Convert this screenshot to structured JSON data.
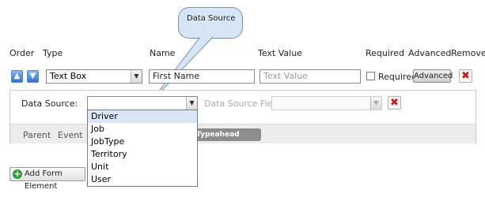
{
  "callout": {
    "label": "Data Source"
  },
  "headers": {
    "order": "Order",
    "type": "Type",
    "name": "Name",
    "text_value": "Text Value",
    "required": "Required",
    "advanced": "Advanced",
    "remove": "Remove"
  },
  "row": {
    "up_icon": "up-arrow",
    "down_icon": "down-arrow",
    "type_value": "Text Box",
    "name_value": "First Name",
    "text_value_placeholder": "Text Value",
    "required_label": "Required",
    "required_checked": false,
    "advanced_button": "Advanced"
  },
  "datasource": {
    "label": "Data Source:",
    "field_label": "Data Source Field:",
    "options": [
      "Driver",
      "Job",
      "JobType",
      "Territory",
      "Unit",
      "User"
    ],
    "highlighted": "Driver"
  },
  "tabs": {
    "parent": "Parent",
    "event": "Event",
    "typeahead": "Typeahead Search"
  },
  "footer": {
    "add_button": "Add Form Element"
  },
  "colors": {
    "remove": "#d01818",
    "add": "#2e9b3e",
    "arrow": "#2f6fd0",
    "highlight": "#d9e6f5"
  }
}
